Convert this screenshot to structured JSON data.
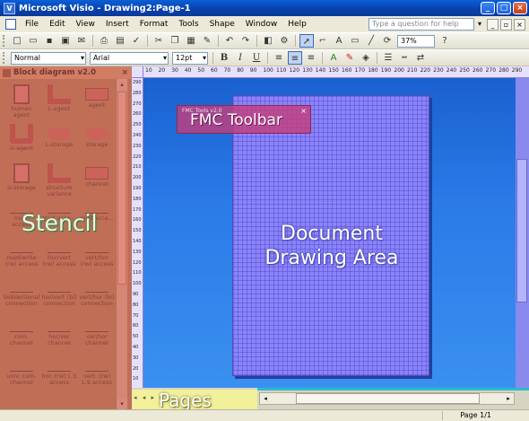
{
  "window": {
    "title": "Microsoft Visio - Drawing2:Page-1",
    "controls": [
      "_",
      "□",
      "×"
    ]
  },
  "menubar": {
    "items": [
      "File",
      "Edit",
      "View",
      "Insert",
      "Format",
      "Tools",
      "Shape",
      "Window",
      "Help"
    ],
    "help_placeholder": "Type a question for help"
  },
  "toolbar1": {
    "zoom": "37%"
  },
  "toolbar2": {
    "style": "Normal",
    "font": "Arial",
    "size": "12pt"
  },
  "stencil": {
    "title": "Block diagram v2.0",
    "overlay_label": "Stencil",
    "shapes": [
      {
        "label": "human agent",
        "icon": "human-agent-icon"
      },
      {
        "label": "L-agent",
        "icon": "l-agent-icon"
      },
      {
        "label": "agent",
        "icon": "agent-icon"
      },
      {
        "label": "U-agent",
        "icon": "u-agent-icon"
      },
      {
        "label": "L-storage",
        "icon": "l-storage-icon"
      },
      {
        "label": "storage",
        "icon": "storage-icon"
      },
      {
        "label": "U-storage",
        "icon": "u-storage-icon"
      },
      {
        "label": "structure variance",
        "icon": "structure-variance-icon"
      },
      {
        "label": "channel",
        "icon": "channel-icon"
      },
      {
        "label": "mod. access",
        "icon": "mod-access-icon"
      },
      {
        "label": "mod.acce...",
        "icon": "mod-access-2-icon"
      },
      {
        "label": "mod.acce...",
        "icon": "mod-access-3-icon"
      },
      {
        "label": "read/write (rw) access",
        "icon": "read-write-access-icon"
      },
      {
        "label": "hor/vert (rw) access",
        "icon": "hor-vert-access-icon"
      },
      {
        "label": "vert/hor (rw) access",
        "icon": "vert-hor-access-icon"
      },
      {
        "label": "bidirectional connection",
        "icon": "bidirectional-connection-icon"
      },
      {
        "label": "hor/vert (bi) connection",
        "icon": "hor-vert-connection-icon"
      },
      {
        "label": "vert/hor (bi) connection",
        "icon": "vert-hor-connection-icon"
      },
      {
        "label": "com. channel",
        "icon": "com-channel-icon"
      },
      {
        "label": "hor/ver channel",
        "icon": "hor-ver-channel-icon"
      },
      {
        "label": "ver/hor channel",
        "icon": "ver-hor-channel-icon"
      },
      {
        "label": "univ. com. channel",
        "icon": "univ-com-channel-icon"
      },
      {
        "label": "hor. (rw) L.S access",
        "icon": "hor-ls-access-icon"
      },
      {
        "label": "vert. (rw) L.S access",
        "icon": "vert-ls-access-icon"
      }
    ]
  },
  "ruler": {
    "top_numbers": [
      "10",
      "20",
      "30",
      "40",
      "50",
      "60",
      "70",
      "80",
      "90",
      "100",
      "110",
      "120",
      "130",
      "140",
      "150",
      "160",
      "170",
      "180",
      "190",
      "200",
      "210",
      "220",
      "230",
      "240",
      "250",
      "260",
      "270",
      "280",
      "290"
    ],
    "left_numbers": [
      "290",
      "280",
      "270",
      "260",
      "250",
      "240",
      "230",
      "220",
      "210",
      "200",
      "190",
      "180",
      "170",
      "160",
      "150",
      "140",
      "130",
      "120",
      "110",
      "100",
      "90",
      "80",
      "70",
      "60",
      "50",
      "40",
      "30",
      "20",
      "10"
    ]
  },
  "fmc_toolbar": {
    "label": "FMC Toolbar",
    "mini_title": "FMC Tools v2.0"
  },
  "drawing": {
    "label_line1": "Document",
    "label_line2": "Drawing Area"
  },
  "bottom": {
    "pages_label": "Pages",
    "nav": "◂ ◂ ▸ ▸"
  },
  "status": {
    "page": "Page 1/1"
  },
  "colors": {
    "stencil_overlay": "#d65c5c",
    "fmc_overlay": "#c83c78",
    "drawing_blue": "#2a7ae8",
    "page_purple": "#8a84f8",
    "pages_yellow": "#f2f09a"
  }
}
